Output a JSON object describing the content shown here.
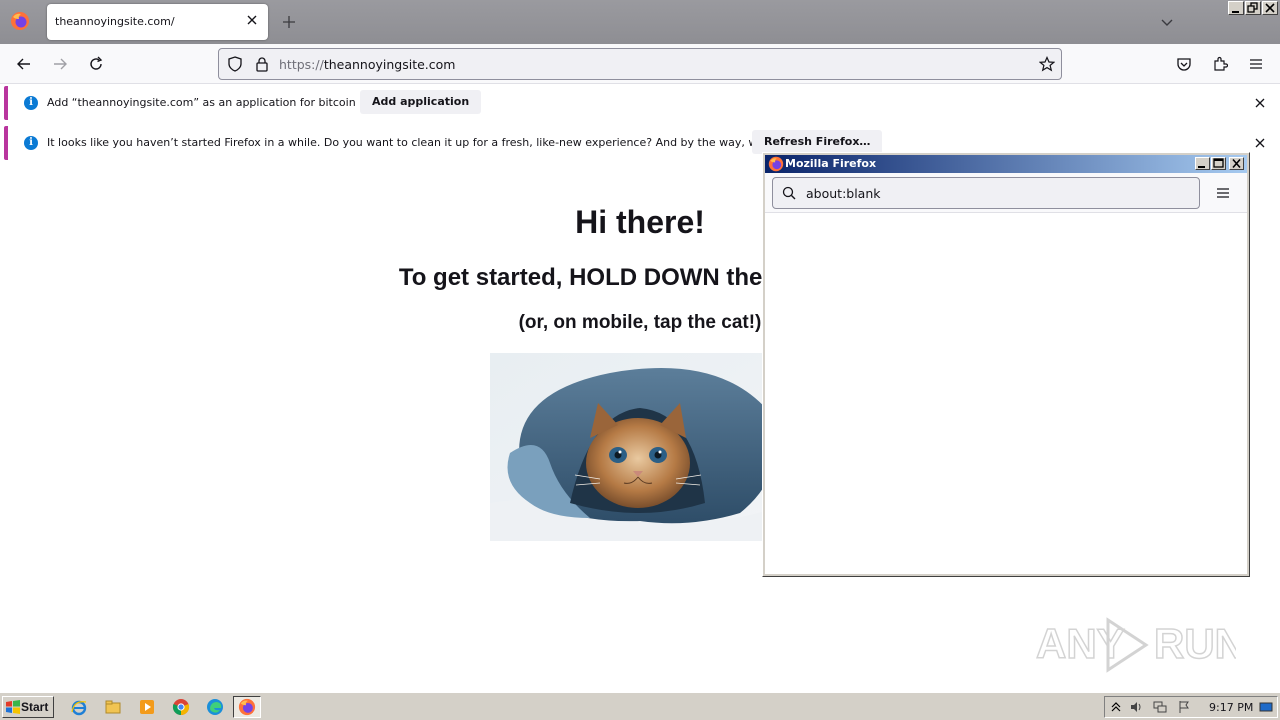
{
  "browser": {
    "tab": {
      "title": "theannoyingsite.com/"
    },
    "url": {
      "scheme": "https://",
      "host": "theannoyingsite.com"
    },
    "icons": [
      "firefox-icon",
      "close-icon",
      "plus-icon",
      "chevron-down-icon",
      "back-icon",
      "forward-icon",
      "reload-icon",
      "shield-icon",
      "lock-icon",
      "star-icon",
      "pocket-icon",
      "extensions-icon",
      "menu-icon"
    ]
  },
  "notifications": [
    {
      "text": "Add “theannoyingsite.com” as an application for bitcoin links?",
      "button": "Add application"
    },
    {
      "text": "It looks like you haven’t started Firefox in a while. Do you want to clean it up for a fresh, like-new experience? And by the way, welcome back!",
      "button": "Refresh Firefox…"
    }
  ],
  "page": {
    "heading": "Hi there!",
    "subheading": "To get started, HOLD DOWN the space bar",
    "mobile_note": "(or, on mobile, tap the cat!)",
    "watermark": "ANY RUN"
  },
  "popup": {
    "title": "Mozilla Firefox",
    "url": "about:blank"
  },
  "taskbar": {
    "start_label": "Start",
    "apps": [
      "ie-icon",
      "explorer-icon",
      "media-player-icon",
      "chrome-icon",
      "edge-icon",
      "firefox-icon"
    ],
    "clock": "9:17 PM"
  },
  "colors": {
    "notif_accent": "#b9359e",
    "info_blue": "#0b7ad4",
    "titlebar_gray": "#8e8e93",
    "taskbar": "#d4d0c8"
  }
}
